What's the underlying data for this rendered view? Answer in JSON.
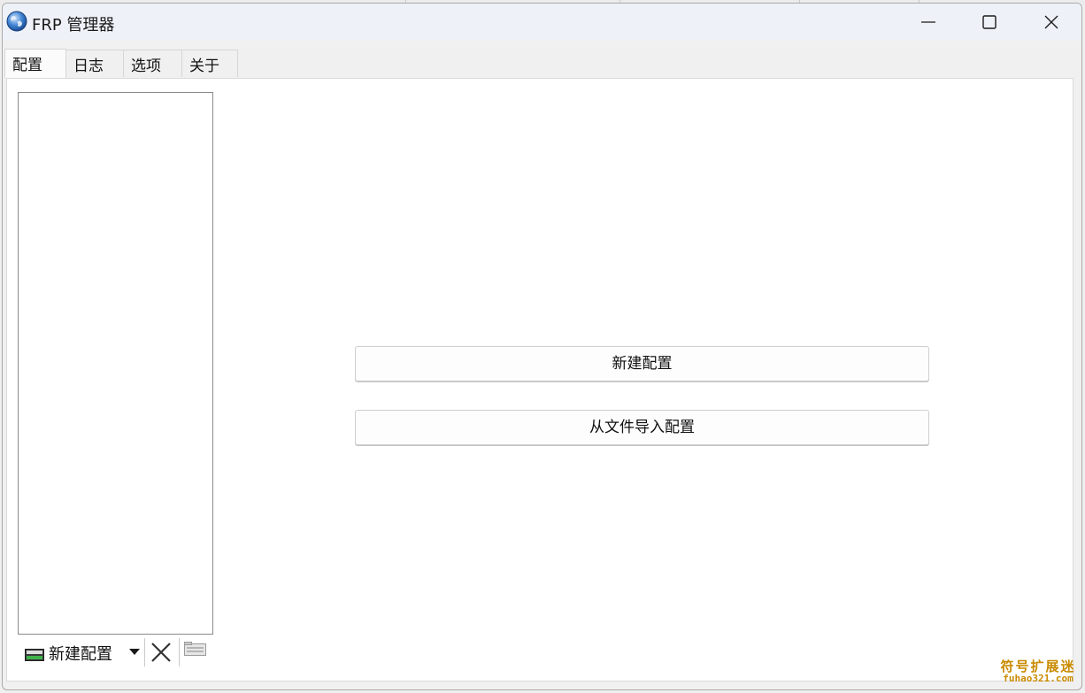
{
  "window": {
    "title": "FRP 管理器"
  },
  "tabs": [
    {
      "label": "配置",
      "active": true
    },
    {
      "label": "日志",
      "active": false
    },
    {
      "label": "选项",
      "active": false
    },
    {
      "label": "关于",
      "active": false
    }
  ],
  "toolbar": {
    "new_label": "新建配置",
    "new_icon": "terminal-icon",
    "delete_icon": "close-x-icon",
    "import_icon": "file-import-icon"
  },
  "main": {
    "new_config_button": "新建配置",
    "import_config_button": "从文件导入配置"
  },
  "watermark": {
    "cn": "符号扩展迷",
    "en": "fuhao321.com"
  }
}
